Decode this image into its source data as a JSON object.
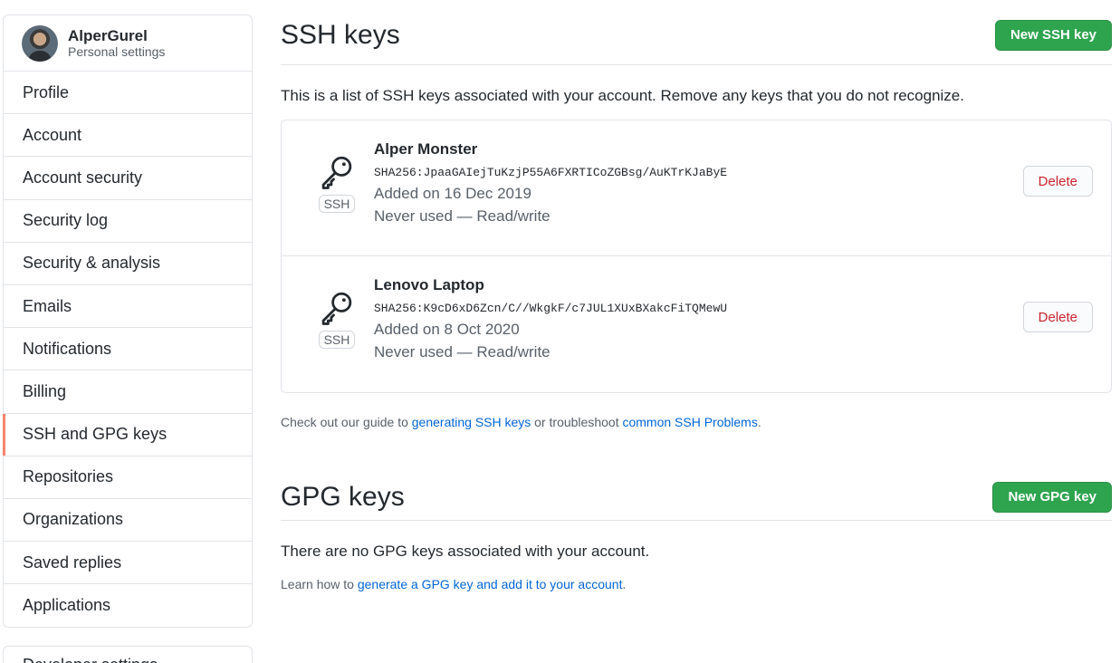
{
  "sidebar": {
    "user_name": "AlperGurel",
    "user_subtitle": "Personal settings",
    "items": [
      {
        "label": "Profile"
      },
      {
        "label": "Account"
      },
      {
        "label": "Account security"
      },
      {
        "label": "Security log"
      },
      {
        "label": "Security & analysis"
      },
      {
        "label": "Emails"
      },
      {
        "label": "Notifications"
      },
      {
        "label": "Billing"
      },
      {
        "label": "SSH and GPG keys"
      },
      {
        "label": "Repositories"
      },
      {
        "label": "Organizations"
      },
      {
        "label": "Saved replies"
      },
      {
        "label": "Applications"
      }
    ],
    "selected": "SSH and GPG keys",
    "second_box_label": "Developer settings"
  },
  "ssh": {
    "title": "SSH keys",
    "new_button": "New SSH key",
    "lead": "This is a list of SSH keys associated with your account. Remove any keys that you do not recognize.",
    "keys": [
      {
        "title": "Alper Monster",
        "fingerprint": "SHA256:JpaaGAIejTuKzjP55A6FXRTICoZGBsg/AuKTrKJaByE",
        "added": "Added on 16 Dec 2019",
        "usage": "Never used — Read/write",
        "badge": "SSH",
        "delete": "Delete"
      },
      {
        "title": "Lenovo Laptop",
        "fingerprint": "SHA256:K9cD6xD6Zcn/C//WkgkF/c7JUL1XUxBXakcFiTQMewU",
        "added": "Added on 8 Oct 2020",
        "usage": "Never used — Read/write",
        "badge": "SSH",
        "delete": "Delete"
      }
    ],
    "note_prefix": "Check out our guide to ",
    "note_link1": "generating SSH keys",
    "note_middle": " or troubleshoot ",
    "note_link2": "common SSH Problems",
    "note_suffix": "."
  },
  "gpg": {
    "title": "GPG keys",
    "new_button": "New GPG key",
    "lead": "There are no GPG keys associated with your account.",
    "note_prefix": "Learn how to ",
    "note_link": "generate a GPG key and add it to your account",
    "note_suffix": "."
  },
  "icons": {
    "key": "key-icon",
    "avatar": "avatar"
  },
  "colors": {
    "primary_button": "#2ea44f",
    "danger_text": "#cb2431",
    "link": "#0366d6",
    "selected_marker": "#f9826c"
  }
}
